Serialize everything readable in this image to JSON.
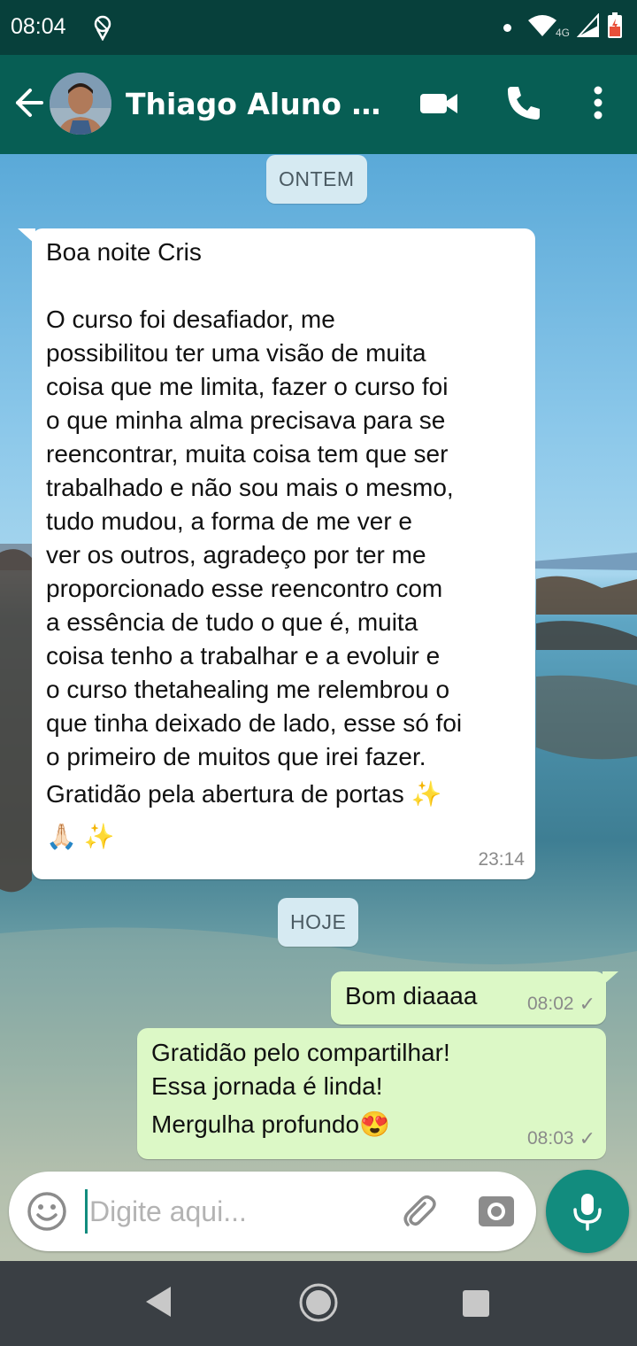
{
  "status_bar": {
    "time": "08:04",
    "network": "4G",
    "icons": [
      "location-icon",
      "wifi-icon",
      "signal-icon",
      "battery-icon"
    ]
  },
  "header": {
    "contact_name": "Thiago Aluno Th...",
    "actions": [
      "video-call-icon",
      "voice-call-icon",
      "more-options-icon"
    ]
  },
  "chat": {
    "date_yesterday": "ONTEM",
    "date_today": "HOJE",
    "messages": [
      {
        "direction": "incoming",
        "lines": [
          "Boa noite Cris",
          "",
          "O curso foi desafiador, me",
          "possibilitou ter uma visão de muita",
          "coisa que me limita, fazer o curso foi",
          "o que minha alma precisava para se",
          "reencontrar, muita coisa tem que ser",
          "trabalhado e não sou mais o mesmo,",
          "tudo mudou, a forma de me ver e",
          "ver os outros, agradeço por ter me",
          "proporcionado esse reencontro com",
          "a essência de tudo o que é, muita",
          "coisa tenho a trabalhar e a evoluir e",
          "o curso thetahealing me relembrou o",
          "que tinha deixado de lado, esse só foi",
          "o primeiro de muitos que irei fazer.",
          "Gratidão pela abertura de portas ✨",
          "🙏🏻 ✨"
        ],
        "time": "23:14"
      },
      {
        "direction": "outgoing",
        "lines": [
          "Bom diaaaa"
        ],
        "time": "08:02",
        "status": "✓"
      },
      {
        "direction": "outgoing",
        "lines": [
          "Gratidão pelo compartilhar!",
          "Essa jornada é linda!",
          "Mergulha profundo😍"
        ],
        "time": "08:03",
        "status": "✓"
      }
    ]
  },
  "composer": {
    "placeholder": "Digite aqui..."
  },
  "colors": {
    "header": "#075e54",
    "status_bar": "#07403b",
    "outgoing_bubble": "#dcf8c6",
    "incoming_bubble": "#ffffff",
    "accent": "#128c7e"
  }
}
